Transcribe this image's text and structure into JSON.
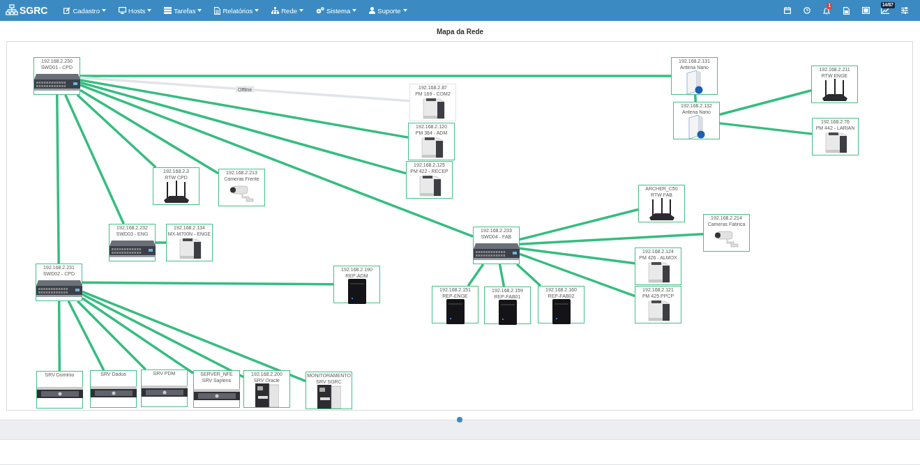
{
  "navbar": {
    "brand": "SGRC",
    "menus": [
      {
        "kind": "edit",
        "label": "Cadastro"
      },
      {
        "kind": "monitor",
        "label": "Hosts"
      },
      {
        "kind": "tasks",
        "label": "Tarefas"
      },
      {
        "kind": "file",
        "label": "Relatórios"
      },
      {
        "kind": "sitemap",
        "label": "Rede"
      },
      {
        "kind": "cogs",
        "label": "Sistema"
      },
      {
        "kind": "user",
        "label": "Suporte"
      }
    ],
    "tools": [
      {
        "kind": "calendar"
      },
      {
        "kind": "clock"
      },
      {
        "kind": "bell",
        "badge": "1"
      },
      {
        "kind": "document"
      },
      {
        "kind": "expand"
      },
      {
        "kind": "chart",
        "badge": "14/87"
      },
      {
        "kind": "sliders"
      }
    ]
  },
  "page_title": "Mapa da Rede",
  "map": {
    "nodes": [
      {
        "kind": "switch",
        "lines": [
          "192.168.2.230",
          "SWD01 - CPD"
        ],
        "online": true
      },
      {
        "kind": "printer",
        "lines": [
          "192.168.2.87",
          "PM 169 - COM2"
        ],
        "online": false,
        "link_label": "Offline"
      },
      {
        "kind": "printer",
        "lines": [
          "192.168.2.120",
          "PM 384 - ADM"
        ],
        "online": true
      },
      {
        "kind": "printer",
        "lines": [
          "192.168.2.125",
          "PM 422 - RECEP"
        ],
        "online": true
      },
      {
        "kind": "router",
        "lines": [
          "192.168.2.3",
          "RTW CPD"
        ],
        "online": true
      },
      {
        "kind": "camera",
        "lines": [
          "192.168.2.213",
          "Cameras Frente"
        ],
        "online": true
      },
      {
        "kind": "switch",
        "lines": [
          "192.168.2.232",
          "SWD03 - ENG"
        ],
        "online": true
      },
      {
        "kind": "printer",
        "lines": [
          "192.168.2.134",
          "MX-M700N - ENGE"
        ],
        "online": true
      },
      {
        "kind": "switch",
        "lines": [
          "192.168.2.231",
          "SWD02 - CPD"
        ],
        "online": true
      },
      {
        "kind": "nas",
        "lines": [
          "192.168.2.190",
          "REP-ADM"
        ],
        "online": true
      },
      {
        "kind": "server",
        "lines": [
          "SRV Dominio"
        ],
        "online": true
      },
      {
        "kind": "server",
        "lines": [
          "SRV Dados"
        ],
        "online": true
      },
      {
        "kind": "server",
        "lines": [
          "SRV PDM"
        ],
        "online": true
      },
      {
        "kind": "server",
        "lines": [
          "SERVER_NFE",
          "SRV Sapiens"
        ],
        "online": true
      },
      {
        "kind": "label-printer",
        "lines": [
          "192.168.2.200",
          "SRV Oracle"
        ],
        "online": true
      },
      {
        "kind": "label-printer",
        "lines": [
          "MONITORAMENTO",
          "SRV SGRC"
        ],
        "online": true
      },
      {
        "kind": "antenna",
        "lines": [
          "192.168.2.131",
          "Antena Nano"
        ],
        "online": true
      },
      {
        "kind": "antenna",
        "lines": [
          "192.168.2.132",
          "Antena Nano"
        ],
        "online": true
      },
      {
        "kind": "router",
        "lines": [
          "192.168.2.211",
          "RTW ENGE"
        ],
        "online": true
      },
      {
        "kind": "printer",
        "lines": [
          "192.168.2.76",
          "PM 442 - LARIAN"
        ],
        "online": true
      },
      {
        "kind": "router",
        "lines": [
          "ARCHER_C50",
          "RTW FAB"
        ],
        "online": true
      },
      {
        "kind": "camera",
        "lines": [
          "192.168.2.214",
          "Cameras Fabrica"
        ],
        "online": true
      },
      {
        "kind": "switch",
        "lines": [
          "192.168.2.233",
          "SWD04 - FAB"
        ],
        "online": true
      },
      {
        "kind": "printer",
        "lines": [
          "192.168.2.124",
          "PM 426 - ALMOX"
        ],
        "online": true
      },
      {
        "kind": "nas",
        "lines": [
          "192.168.2.151",
          "REP-ENGE"
        ],
        "online": true
      },
      {
        "kind": "nas",
        "lines": [
          "192.168.2.159",
          "REP-FAB01"
        ],
        "online": true
      },
      {
        "kind": "nas",
        "lines": [
          "192.168.2.160",
          "REP-FAB02"
        ],
        "online": true
      },
      {
        "kind": "printer",
        "lines": [
          "192.168.2.121",
          "PM 425 PPCP"
        ],
        "online": true
      }
    ]
  }
}
